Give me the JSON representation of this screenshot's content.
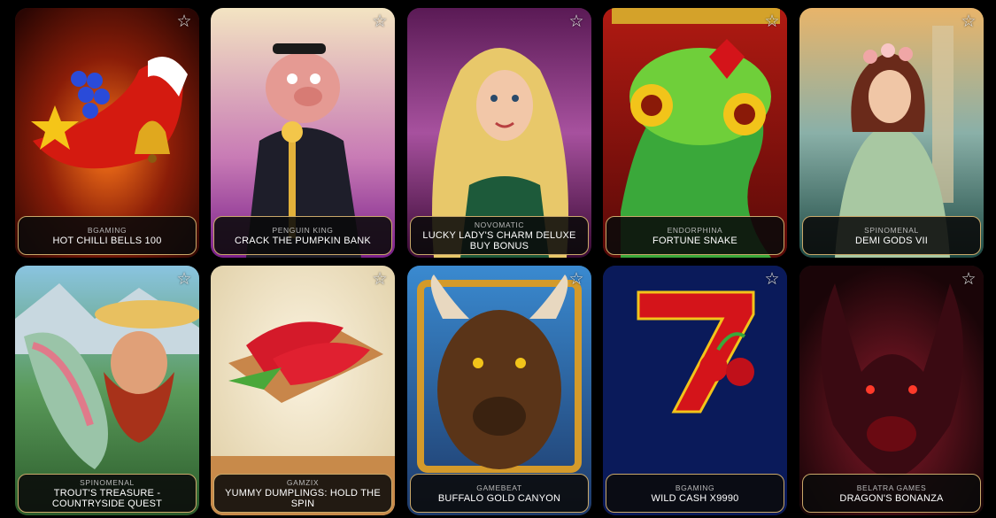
{
  "favorite_icon": "star-outline-icon",
  "games": [
    {
      "provider": "BGAMING",
      "title": "HOT CHILLI BELLS 100"
    },
    {
      "provider": "PENGUIN KING",
      "title": "CRACK THE PUMPKIN BANK"
    },
    {
      "provider": "NOVOMATIC",
      "title": "LUCKY LADY'S CHARM DELUXE BUY BONUS"
    },
    {
      "provider": "ENDORPHINA",
      "title": "FORTUNE SNAKE"
    },
    {
      "provider": "SPINOMENAL",
      "title": "DEMI GODS VII"
    },
    {
      "provider": "SPINOMENAL",
      "title": "TROUT'S TREASURE - COUNTRYSIDE QUEST"
    },
    {
      "provider": "GAMZIX",
      "title": "YUMMY DUMPLINGS: HOLD THE SPIN"
    },
    {
      "provider": "GAMEBEAT",
      "title": "BUFFALO GOLD CANYON"
    },
    {
      "provider": "BGAMING",
      "title": "WILD CASH X9990"
    },
    {
      "provider": "BELATRA GAMES",
      "title": "DRAGON'S BONANZA"
    }
  ]
}
